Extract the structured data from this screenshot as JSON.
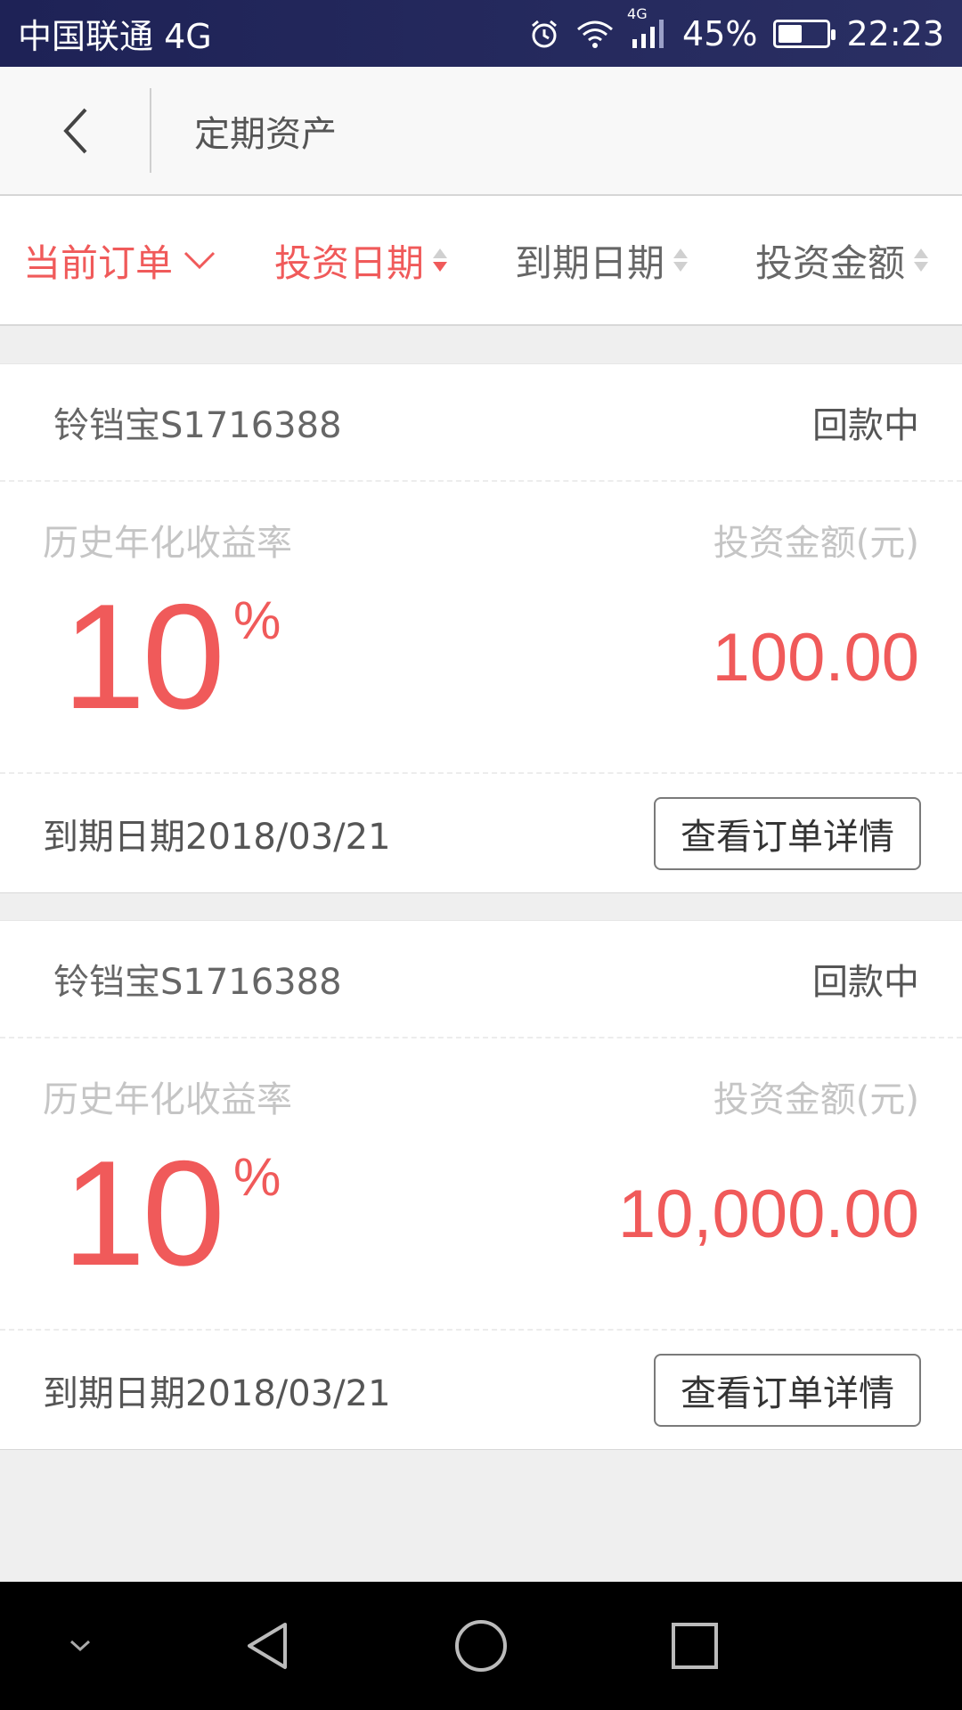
{
  "status_bar": {
    "carrier": "中国联通 4G",
    "network_badge": "4G",
    "battery": "45%",
    "time": "22:23",
    "battery_level": 0.45
  },
  "header": {
    "title": "定期资产"
  },
  "filters": [
    {
      "label": "当前订单",
      "active": true,
      "icon": "chevron-down-icon"
    },
    {
      "label": "投资日期",
      "active": true,
      "icon": "sort-icon"
    },
    {
      "label": "到期日期",
      "active": false,
      "icon": "sort-icon"
    },
    {
      "label": "投资金额",
      "active": false,
      "icon": "sort-icon"
    }
  ],
  "orders": [
    {
      "product": "铃铛宝S1716388",
      "status": "回款中",
      "rate_label": "历史年化收益率",
      "rate": "10",
      "rate_unit": "%",
      "amount_label": "投资金额(元)",
      "amount": "100.00",
      "due": "到期日期2018/03/21",
      "detail_button": "查看订单详情"
    },
    {
      "product": "铃铛宝S1716388",
      "status": "回款中",
      "rate_label": "历史年化收益率",
      "rate": "10",
      "rate_unit": "%",
      "amount_label": "投资金额(元)",
      "amount": "10,000.00",
      "due": "到期日期2018/03/21",
      "detail_button": "查看订单详情"
    }
  ],
  "colors": {
    "accent": "#f05a5a",
    "status_bar": "#1e2256"
  }
}
